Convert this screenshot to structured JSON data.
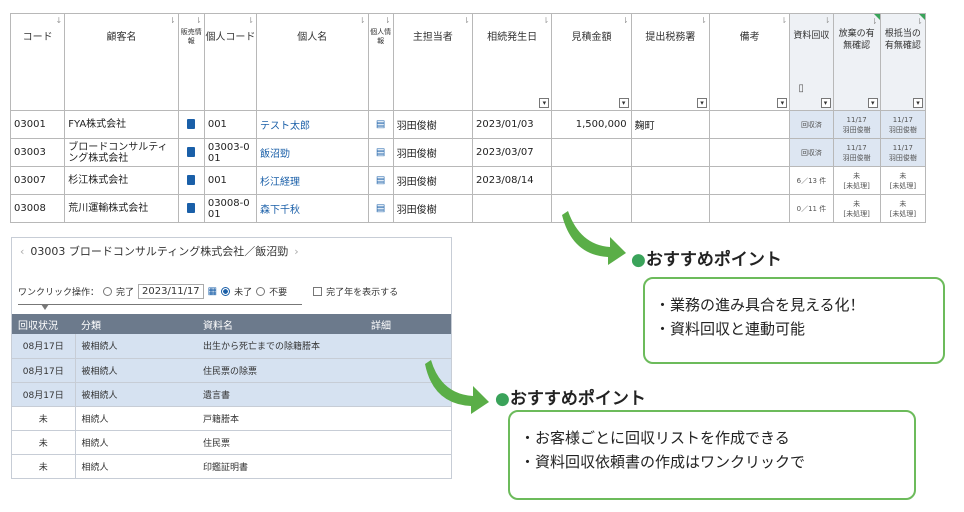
{
  "grid": {
    "headers": [
      "コード",
      "顧客名",
      "販売情報",
      "個人コード",
      "個人名",
      "個人情報",
      "主担当者",
      "相続発生日",
      "見積金額",
      "提出税務署",
      "備考",
      "資料回収",
      "放棄の有無確認",
      "根抵当の有無確認"
    ],
    "rows": [
      {
        "code": "03001",
        "customer": "FYA株式会社",
        "pcode": "001",
        "pname": "テスト太郎",
        "owner": "羽田俊樹",
        "date": "2023/01/03",
        "amount": "1,500,000",
        "office": "麹町",
        "collect": "回収済",
        "waive": "11/17\n羽田俊樹",
        "lien": "11/17\n羽田俊樹"
      },
      {
        "code": "03003",
        "customer": "ブロードコンサルティング株式会社",
        "pcode": "03003-0\n01",
        "pname": "飯沼勁",
        "owner": "羽田俊樹",
        "date": "2023/03/07",
        "amount": "",
        "office": "",
        "collect": "回収済",
        "waive": "11/17\n羽田俊樹",
        "lien": "11/17\n羽田俊樹"
      },
      {
        "code": "03007",
        "customer": "杉江株式会社",
        "pcode": "001",
        "pname": "杉江経理",
        "owner": "羽田俊樹",
        "date": "2023/08/14",
        "amount": "",
        "office": "",
        "collect": "6／13 件",
        "waive": "未\n[未処理]",
        "lien": "未\n[未処理]"
      },
      {
        "code": "03008",
        "customer": "荒川運輸株式会社",
        "pcode": "03008-0\n01",
        "pname": "森下千秋",
        "owner": "羽田俊樹",
        "date": "",
        "amount": "",
        "office": "",
        "collect": "0／11 件",
        "waive": "未\n[未処理]",
        "lien": "未\n[未処理]"
      }
    ]
  },
  "panel": {
    "breadcrumb": "03003 ブロードコンサルティング株式会社／飯沼勁",
    "oneclick_label": "ワンクリック操作：",
    "opt_done": "完了",
    "date_value": "2023/11/17",
    "opt_notdone": "未了",
    "opt_unneeded": "不要",
    "show_done_label": "完了年を表示する",
    "columns": [
      "回収状況",
      "分類",
      "資料名",
      "詳細"
    ],
    "rows": [
      {
        "status": "08月17日",
        "done": true,
        "category": "被相続人",
        "doc": "出生から死亡までの除籍謄本"
      },
      {
        "status": "08月17日",
        "done": true,
        "category": "被相続人",
        "doc": "住民票の除票"
      },
      {
        "status": "08月17日",
        "done": true,
        "category": "被相続人",
        "doc": "遺言書"
      },
      {
        "status": "未",
        "done": false,
        "category": "相続人",
        "doc": "戸籍謄本"
      },
      {
        "status": "未",
        "done": false,
        "category": "相続人",
        "doc": "住民票"
      },
      {
        "status": "未",
        "done": false,
        "category": "相続人",
        "doc": "印鑑証明書"
      }
    ]
  },
  "callout1": {
    "title": "おすすめポイント",
    "lines": [
      "・業務の進み具合を見える化！",
      "・資料回収と連動可能"
    ]
  },
  "callout2": {
    "title": "おすすめポイント",
    "lines": [
      "・お客様ごとに回収リストを作成できる",
      "・資料回収依頼書の作成はワンクリックで"
    ]
  },
  "colors": {
    "accent_green": "#3aa35a",
    "box_border": "#6cbb5b",
    "link_blue": "#1a5fa8",
    "header_gray": "#6c7a8c",
    "done_blue": "#d6e2f1"
  }
}
